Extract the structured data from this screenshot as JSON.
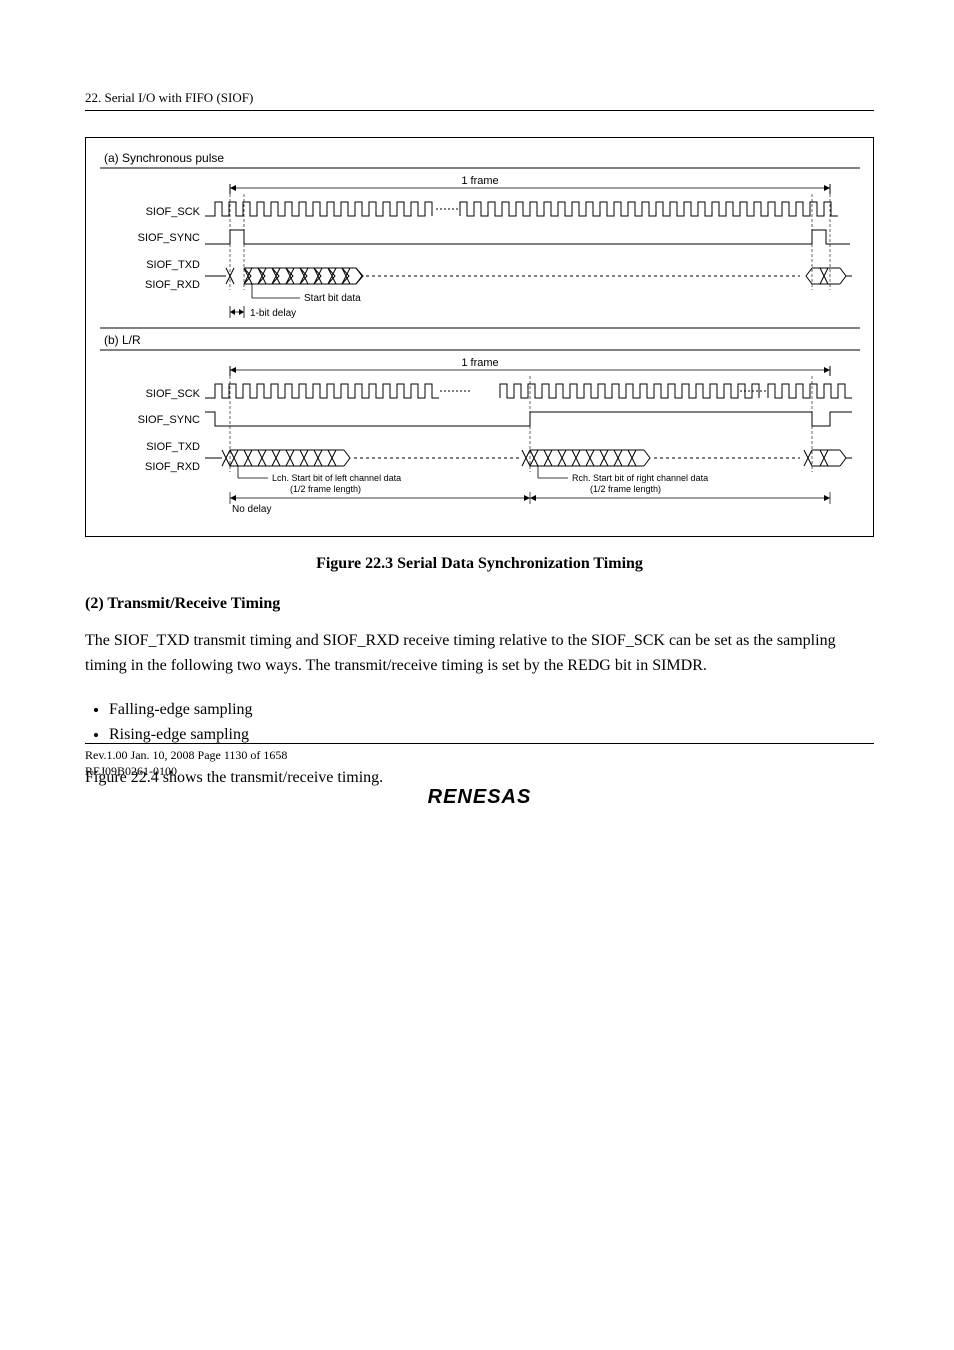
{
  "header": {
    "title": "22.   Serial I/O with FIFO (SIOF)"
  },
  "figure": {
    "panel_a": {
      "title": "(a) Synchronous pulse",
      "frame_label": "1 frame",
      "signals": [
        "SIOF_SCK",
        "SIOF_SYNC",
        "SIOF_TXD",
        "SIOF_RXD"
      ],
      "start_label": "Start bit data",
      "delay_label": "1-bit delay"
    },
    "panel_b": {
      "title": "(b) L/R",
      "frame_label": "1 frame",
      "signals": [
        "SIOF_SCK",
        "SIOF_SYNC",
        "SIOF_TXD",
        "SIOF_RXD"
      ],
      "lch_label": "Lch. Start bit of left channel data\n(1/2 frame length)",
      "rch_label": "Rch. Start bit of right channel data\n(1/2 frame length)",
      "nodelay_label": "No delay"
    },
    "caption": "Figure 22.3   Serial Data Synchronization Timing"
  },
  "section": {
    "heading": "(2)    Transmit/Receive Timing",
    "para1": "The SIOF_TXD transmit timing and SIOF_RXD receive timing relative to the SIOF_SCK can be set as the sampling timing in the following two ways. The transmit/receive timing is set by the REDG bit in SIMDR.",
    "bullets": [
      "Falling-edge sampling",
      "Rising-edge sampling"
    ],
    "para2": "Figure 22.4 shows the transmit/receive timing."
  },
  "footer": {
    "line1": "Rev.1.00  Jan. 10, 2008  Page 1130 of 1658",
    "line2": "REJ09B0261-0100",
    "logo": "RENESAS"
  },
  "chart_data": [
    {
      "type": "timing-diagram",
      "title": "(a) Synchronous pulse",
      "frame_label": "1 frame",
      "signals": [
        {
          "name": "SIOF_SCK",
          "description": "continuous clock spanning full frame"
        },
        {
          "name": "SIOF_SYNC",
          "description": "single high pulse at frame start, low for rest of frame"
        },
        {
          "name": "SIOF_TXD",
          "description": "data burst (~8 bits) starting 1-bit after sync pulse, then inactive, resumes next frame"
        },
        {
          "name": "SIOF_RXD",
          "description": "same timing as SIOF_TXD"
        }
      ],
      "annotations": [
        {
          "text": "Start bit data",
          "target": "first bit of TXD/RXD burst"
        },
        {
          "text": "1-bit delay",
          "target": "gap between SIOF_SYNC rising edge and data start"
        }
      ]
    },
    {
      "type": "timing-diagram",
      "title": "(b) L/R",
      "frame_label": "1 frame",
      "signals": [
        {
          "name": "SIOF_SCK",
          "description": "continuous clock spanning full frame"
        },
        {
          "name": "SIOF_SYNC",
          "description": "low for first half-frame (L), high for second half-frame (R)"
        },
        {
          "name": "SIOF_TXD",
          "description": "left-channel data burst at start of frame, right-channel data burst at half-frame"
        },
        {
          "name": "SIOF_RXD",
          "description": "same timing as SIOF_TXD"
        }
      ],
      "annotations": [
        {
          "text": "Lch. Start bit of left channel data (1/2 frame length)",
          "target": "first half of frame"
        },
        {
          "text": "Rch. Start bit of right channel data (1/2 frame length)",
          "target": "second half of frame"
        },
        {
          "text": "No delay",
          "target": "data starts immediately at SYNC edge"
        }
      ]
    }
  ]
}
